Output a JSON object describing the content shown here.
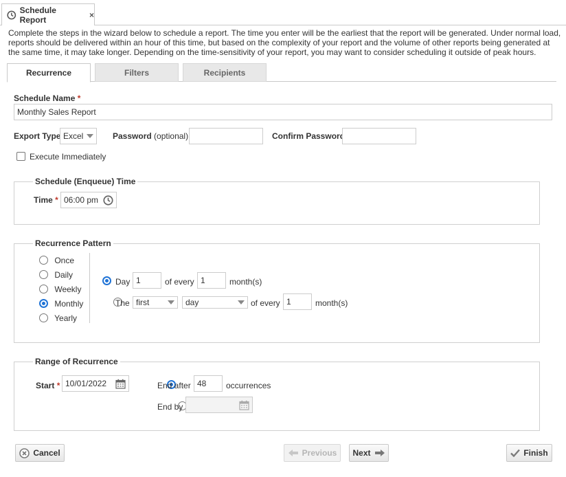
{
  "doc_tab": {
    "title": "Schedule Report",
    "close": "×"
  },
  "intro": "Complete the steps in the wizard below to schedule a report. The time you enter will be the earliest that the report will be generated. Under normal load, reports should be delivered within an hour of this time, but based on the complexity of your report and the volume of other reports being generated at the same time, it may take longer. Depending on the time-sensitivity of your report, you may want to consider scheduling it outside of peak hours.",
  "wizard_tabs": [
    {
      "label": "Recurrence",
      "active": true
    },
    {
      "label": "Filters",
      "active": false
    },
    {
      "label": "Recipients",
      "active": false
    }
  ],
  "form": {
    "schedule_name_label": "Schedule Name",
    "required_mark": "*",
    "schedule_name_value": "Monthly Sales Report",
    "export_type_label": "Export Type",
    "export_type_value": "Excel",
    "password_label": "Password",
    "password_optional": "(optional)",
    "password_value": "",
    "confirm_password_label": "Confirm Password",
    "confirm_password_value": "",
    "execute_immediately_label": "Execute Immediately",
    "execute_immediately_checked": false
  },
  "enqueue": {
    "legend": "Schedule (Enqueue) Time",
    "time_label": "Time",
    "time_value": "06:00 pm"
  },
  "pattern": {
    "legend": "Recurrence Pattern",
    "options": [
      {
        "label": "Once",
        "selected": false
      },
      {
        "label": "Daily",
        "selected": false
      },
      {
        "label": "Weekly",
        "selected": false
      },
      {
        "label": "Monthly",
        "selected": true
      },
      {
        "label": "Yearly",
        "selected": false
      }
    ],
    "day_option_label": "Day",
    "day_value": "1",
    "of_every_label": "of every",
    "every_months_value": "1",
    "months_label": "month(s)",
    "the_option_label": "The",
    "ordinal_value": "first",
    "weekday_value": "day",
    "of_every_label_2": "of every",
    "every_months_value_2": "1",
    "months_label_2": "month(s)"
  },
  "range": {
    "legend": "Range of Recurrence",
    "start_label": "Start",
    "start_value": "10/01/2022",
    "end_after_label": "End after",
    "end_after_value": "48",
    "occurrences_label": "occurrences",
    "end_by_label": "End by",
    "end_by_value": ""
  },
  "buttons": {
    "cancel": "Cancel",
    "previous": "Previous",
    "next": "Next",
    "finish": "Finish"
  },
  "colors": {
    "accent": "#1f73d6",
    "required": "#c0392b",
    "cancel_icon": "#7a7a7a",
    "finish_icon": "#7a7a7a"
  }
}
